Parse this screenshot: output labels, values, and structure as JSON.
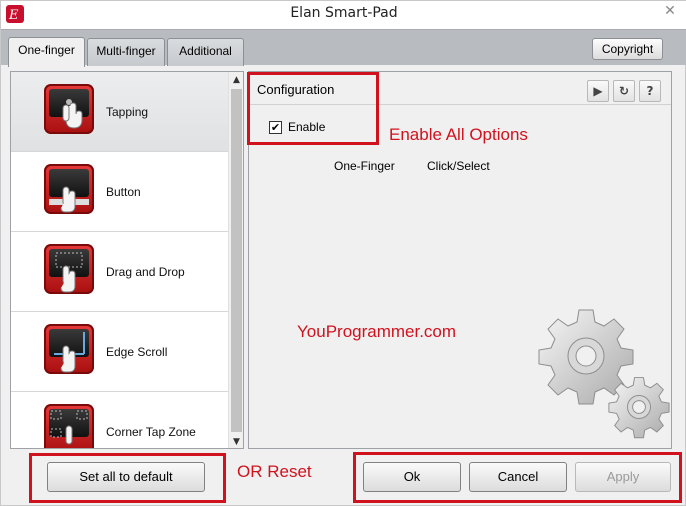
{
  "window": {
    "title": "Elan Smart-Pad",
    "close": "✕"
  },
  "tabs": [
    {
      "label": "One-finger",
      "active": true
    },
    {
      "label": "Multi-finger",
      "active": false
    },
    {
      "label": "Additional",
      "active": false
    }
  ],
  "header": {
    "copyright_label": "Copyright"
  },
  "sidebar": {
    "items": [
      {
        "label": "Tapping",
        "icon": "tapping-icon",
        "selected": true
      },
      {
        "label": "Button",
        "icon": "button-icon",
        "selected": false
      },
      {
        "label": "Drag and Drop",
        "icon": "drag-drop-icon",
        "selected": false
      },
      {
        "label": "Edge Scroll",
        "icon": "edge-scroll-icon",
        "selected": false
      },
      {
        "label": "Corner Tap Zone",
        "icon": "corner-tap-icon",
        "selected": false
      }
    ]
  },
  "config": {
    "title": "Configuration",
    "enable_label": "Enable",
    "enable_checked": true,
    "finger": "One-Finger",
    "action": "Click/Select",
    "toolbar": {
      "play": "▶",
      "refresh": "↻",
      "help": "?"
    }
  },
  "buttons": {
    "default": "Set all to default",
    "ok": "Ok",
    "cancel": "Cancel",
    "apply": "Apply"
  },
  "annotations": {
    "enable": "Enable All Options",
    "site": "YouProgrammer.com",
    "reset": "OR Reset"
  },
  "colors": {
    "accent": "#d0121e",
    "tab_bar": "#b8bcc0",
    "icon_red": "#c8102e"
  }
}
